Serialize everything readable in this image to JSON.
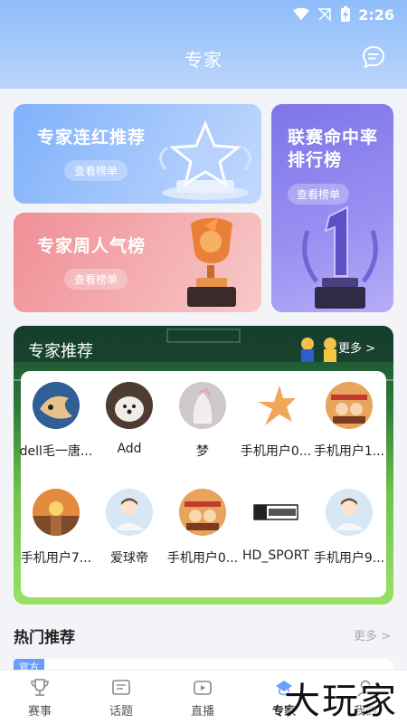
{
  "status_bar": {
    "time": "2:26"
  },
  "header": {
    "title": "专家"
  },
  "cards": {
    "streak": {
      "title": "专家连红推荐",
      "button": "查看榜单"
    },
    "weekly": {
      "title": "专家周人气榜",
      "button": "查看榜单"
    },
    "hitrate": {
      "title_line1": "联赛命中率",
      "title_line2": "排行榜",
      "button": "查看榜单"
    }
  },
  "experts": {
    "title": "专家推荐",
    "more": "更多 >",
    "items": [
      {
        "name": "dell毛一唐...",
        "avatar": "cat-painting-avatar"
      },
      {
        "name": "Add",
        "avatar": "dog-avatar"
      },
      {
        "name": "梦",
        "avatar": "sculpture-avatar"
      },
      {
        "name": "手机用户0...",
        "avatar": "star-logo-avatar"
      },
      {
        "name": "手机用户1...",
        "avatar": "cartoon-avatar"
      },
      {
        "name": "手机用户7...",
        "avatar": "sunset-avatar"
      },
      {
        "name": "爱球帝",
        "avatar": "default-avatar"
      },
      {
        "name": "手机用户0...",
        "avatar": "cartoon-avatar"
      },
      {
        "name": "HD_SPORT",
        "avatar": "hdsport-logo-avatar"
      },
      {
        "name": "手机用户9...",
        "avatar": "default-avatar"
      }
    ]
  },
  "hot": {
    "title": "热门推荐",
    "more": "更多 >",
    "badge": "官方"
  },
  "nav": {
    "items": [
      {
        "label": "赛事",
        "icon": "trophy-icon"
      },
      {
        "label": "话题",
        "icon": "topic-icon"
      },
      {
        "label": "直播",
        "icon": "live-icon"
      },
      {
        "label": "专家",
        "icon": "expert-icon"
      },
      {
        "label": "我的",
        "icon": "profile-icon"
      }
    ],
    "active_index": 3
  },
  "watermark": "大玩家",
  "colors": {
    "accent": "#6a9ef9",
    "header": "#9ec4fa"
  }
}
